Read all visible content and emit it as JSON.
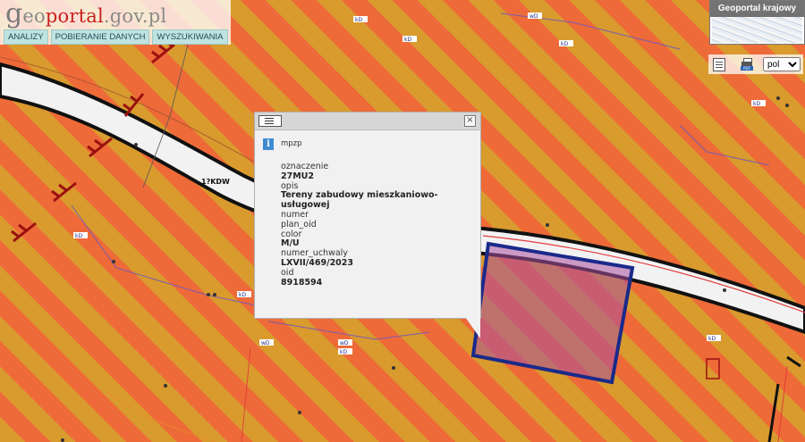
{
  "header": {
    "logo_g": "g",
    "logo_text_a": "eo",
    "logo_text_b": "portal",
    "logo_text_c": ".gov.pl",
    "nav": [
      "ANALIZY",
      "POBIERANIE DANYCH",
      "WYSZUKIWANIA"
    ]
  },
  "geoportal_krajowy": {
    "title": "Geoportal krajowy"
  },
  "toolbar": {
    "language": "pol",
    "language_options": [
      "pol"
    ]
  },
  "map": {
    "road_label": "1?KDW"
  },
  "popup": {
    "layer": "mpzp",
    "attributes": [
      {
        "key": "oznaczenie",
        "value": "27MU2"
      },
      {
        "key": "opis",
        "value": "Tereny zabudowy mieszkaniowo-usługowej"
      },
      {
        "key": "numer",
        "value": ""
      },
      {
        "key": "plan_oid",
        "value": ""
      },
      {
        "key": "color",
        "value": "M/U"
      },
      {
        "key": "numer_uchwaly",
        "value": "LXVII/469/2023"
      },
      {
        "key": "oid",
        "value": "8918594"
      }
    ]
  },
  "colors": {
    "stripe_a": "#d99a2e",
    "stripe_b": "#ee6a38",
    "parcel_outline": "#1a2a8a",
    "popup_bg": "#f1f1f1"
  }
}
